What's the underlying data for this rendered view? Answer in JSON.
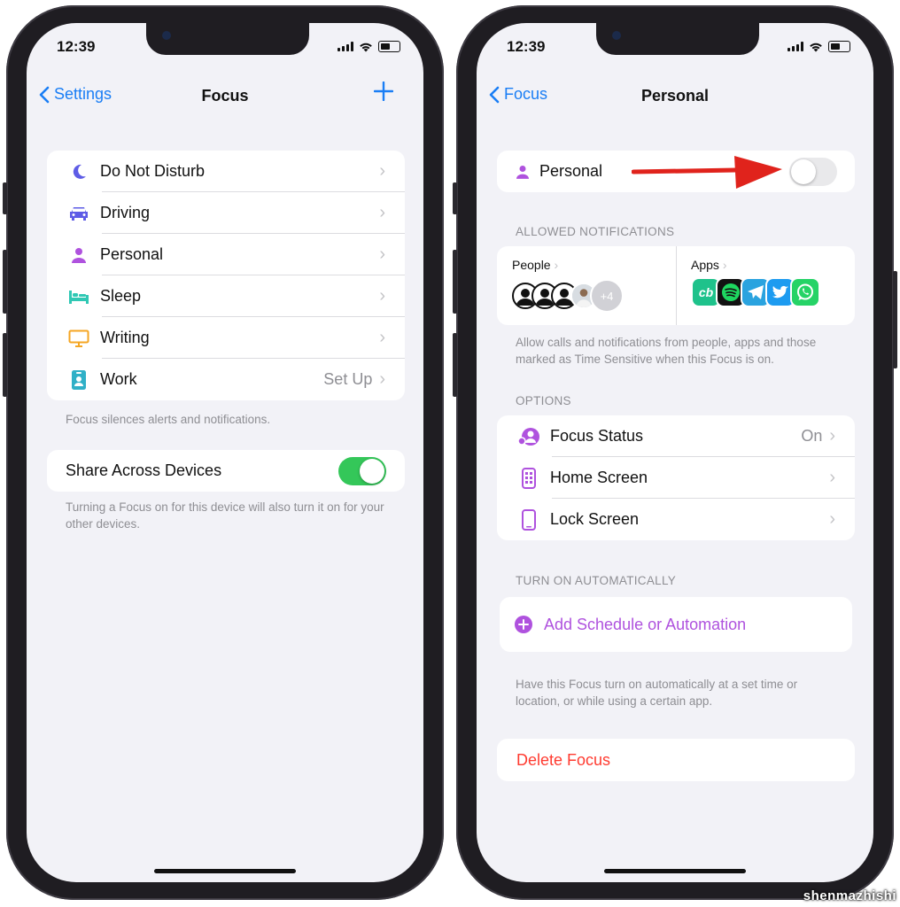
{
  "status": {
    "time": "12:39"
  },
  "left": {
    "nav": {
      "back": "Settings",
      "title": "Focus"
    },
    "items": [
      {
        "label": "Do Not Disturb",
        "value": "",
        "icon": "moon-icon",
        "color": "#5e5ce6"
      },
      {
        "label": "Driving",
        "value": "",
        "icon": "car-icon",
        "color": "#5e5ce6"
      },
      {
        "label": "Personal",
        "value": "",
        "icon": "person-icon",
        "color": "#af52de"
      },
      {
        "label": "Sleep",
        "value": "",
        "icon": "bed-icon",
        "color": "#30c8b4"
      },
      {
        "label": "Writing",
        "value": "",
        "icon": "monitor-icon",
        "color": "#f5a623"
      },
      {
        "label": "Work",
        "value": "Set Up",
        "icon": "badge-icon",
        "color": "#30b0c7"
      }
    ],
    "list_footer": "Focus silences alerts and notifications.",
    "share": {
      "label": "Share Across Devices",
      "enabled": true
    },
    "share_footer": "Turning a Focus on for this device will also turn it on for your other devices."
  },
  "right": {
    "nav": {
      "back": "Focus",
      "title": "Personal"
    },
    "toggle_row": {
      "label": "Personal",
      "enabled": false
    },
    "allowed_header": "ALLOWED NOTIFICATIONS",
    "people": {
      "label": "People",
      "more": "+4"
    },
    "apps": {
      "label": "Apps",
      "first_app_text": "cb"
    },
    "allowed_footer": "Allow calls and notifications from people, apps and those marked as Time Sensitive when this Focus is on.",
    "options_header": "OPTIONS",
    "options": [
      {
        "label": "Focus Status",
        "value": "On",
        "icon": "focus-status-icon"
      },
      {
        "label": "Home Screen",
        "value": "",
        "icon": "home-screen-icon"
      },
      {
        "label": "Lock Screen",
        "value": "",
        "icon": "lock-screen-icon"
      }
    ],
    "auto_header": "TURN ON AUTOMATICALLY",
    "add_schedule": "Add Schedule or Automation",
    "auto_footer": "Have this Focus turn on automatically at a set time or location, or while using a certain app.",
    "delete": "Delete Focus"
  },
  "colors": {
    "accent": "#1a7ef5",
    "purple": "#af52de",
    "green": "#34c759",
    "red": "#ff3b30",
    "arrow": "#e0231c"
  },
  "watermark": "shenmazhishi"
}
